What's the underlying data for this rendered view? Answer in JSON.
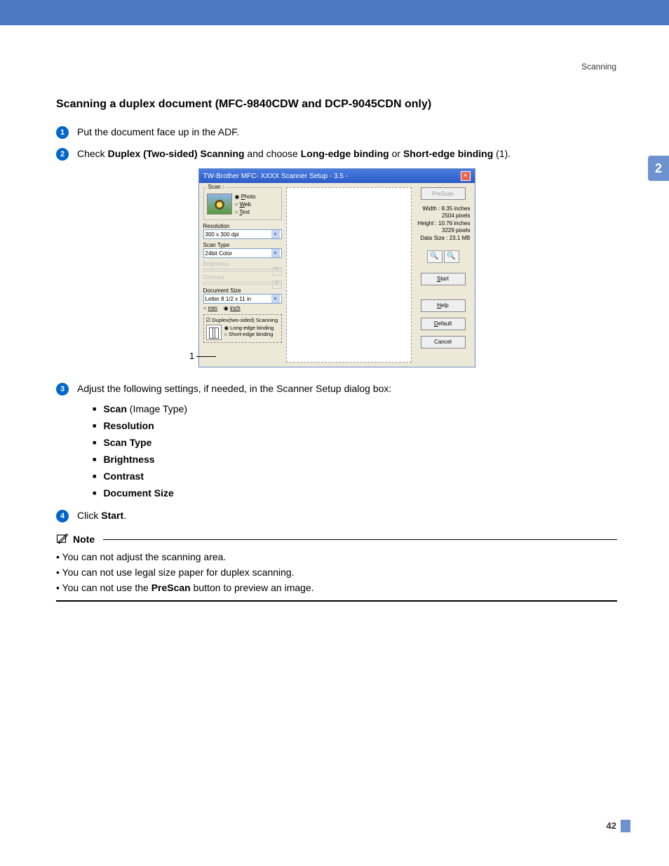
{
  "header": {
    "label": "Scanning"
  },
  "chapter_tab": "2",
  "page_number": "42",
  "section_title": "Scanning a duplex document (MFC-9840CDW and DCP-9045CDN only)",
  "steps": {
    "s1": {
      "num": "1",
      "text": "Put the document face up in the ADF."
    },
    "s2": {
      "num": "2",
      "prefix": "Check ",
      "b1": "Duplex (Two-sided) Scanning",
      "mid": " and choose ",
      "b2": "Long-edge binding",
      "or": " or ",
      "b3": "Short-edge binding",
      "suffix": " (1)."
    },
    "s3": {
      "num": "3",
      "text": "Adjust the following settings, if needed, in the Scanner Setup dialog box:"
    },
    "s4": {
      "num": "4",
      "prefix": "Click ",
      "b1": "Start",
      "suffix": "."
    }
  },
  "callout_1": "1",
  "dialog": {
    "title": "TW-Brother MFC- XXXX  Scanner Setup - 3.5 -",
    "scan_label": "Scan :",
    "radio_photo": "Photo",
    "radio_web": "Web",
    "radio_text": "Text",
    "resolution_label": "Resolution",
    "resolution_value": "300 x 300 dpi",
    "scantype_label": "Scan Type",
    "scantype_value": "24bit Color",
    "brightness_label": "Brightness",
    "brightness_value": "0",
    "contrast_label": "Contrast",
    "contrast_value": "0",
    "docsize_label": "Document Size",
    "docsize_value": "Letter 8 1/2 x 11 in",
    "unit_mm": "mm",
    "unit_inch": "inch",
    "duplex_check": "Duplex(two-sided) Scanning",
    "duplex_long": "Long-edge binding",
    "duplex_short": "Short-edge binding",
    "btn_prescan": "PreScan",
    "info_width_l": "Width :",
    "info_width_v": "8.35 inches",
    "info_width_px": "2504 pixels",
    "info_height_l": "Height :",
    "info_height_v": "10.76 inches",
    "info_height_px": "3229 pixels",
    "info_size_l": "Data Size :",
    "info_size_v": "23.1 MB",
    "btn_start": "Start",
    "btn_help": "Help",
    "btn_default": "Default",
    "btn_cancel": "Cancel"
  },
  "sublist": {
    "i1_b": "Scan",
    "i1_t": " (Image Type)",
    "i2": "Resolution",
    "i3": "Scan Type",
    "i4": "Brightness",
    "i5": "Contrast",
    "i6": "Document Size"
  },
  "note": {
    "title": "Note",
    "n1": "You can not adjust the scanning area.",
    "n2": "You can not use legal size paper for duplex scanning.",
    "n3_a": "You can not use the ",
    "n3_b": "PreScan",
    "n3_c": " button to preview an image."
  }
}
